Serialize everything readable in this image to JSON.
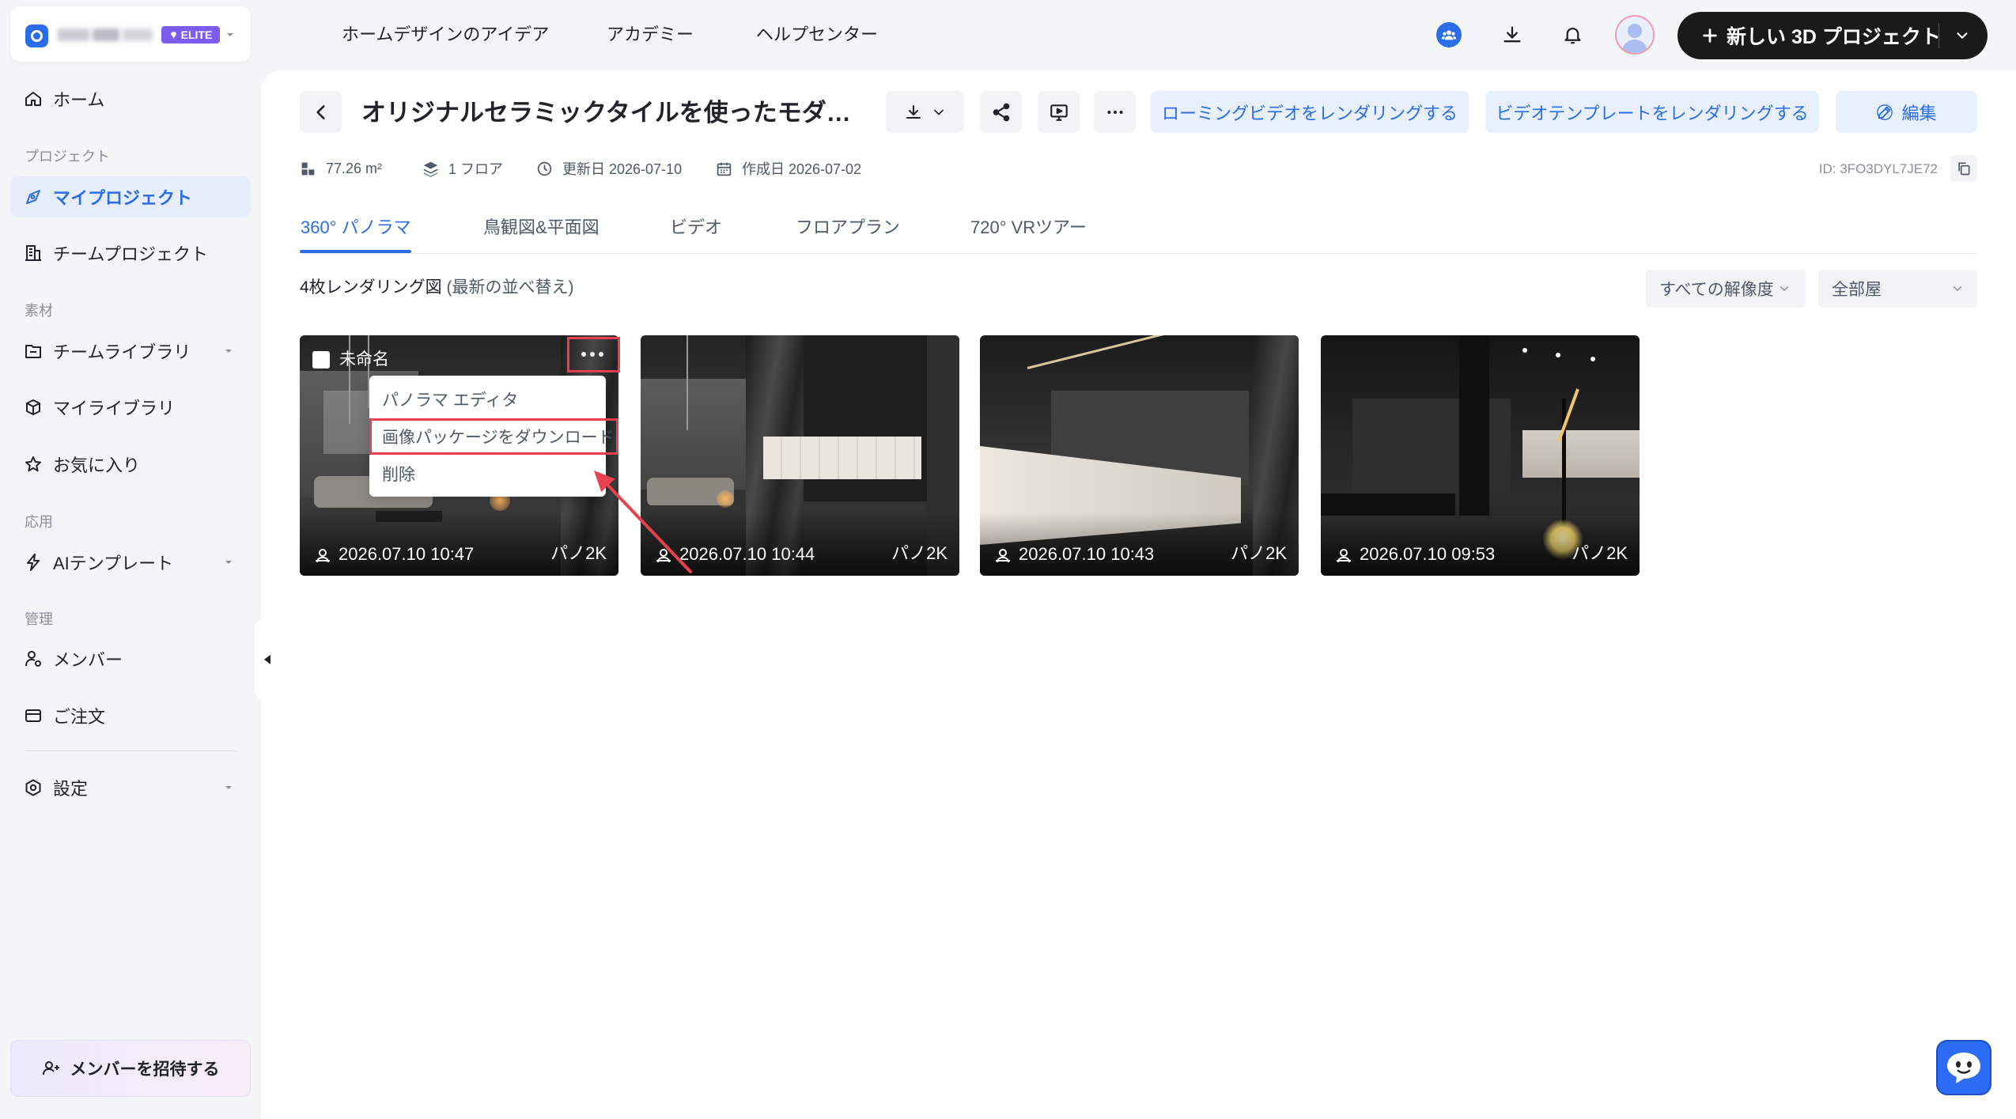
{
  "sidebar": {
    "brand_badge": "ELITE",
    "home": "ホーム",
    "sections": {
      "project": "プロジェクト",
      "material": "素材",
      "apps": "応用",
      "admin": "管理"
    },
    "items": {
      "my_projects": "マイプロジェクト",
      "team_projects": "チームプロジェクト",
      "team_library": "チームライブラリ",
      "my_library": "マイライブラリ",
      "favorites": "お気に入り",
      "ai_templates": "AIテンプレート",
      "members": "メンバー",
      "orders": "ご注文",
      "settings": "設定"
    },
    "invite_button": "メンバーを招待する"
  },
  "header": {
    "nav": [
      "ホームデザインのアイデア",
      "アカデミー",
      "ヘルプセンター"
    ],
    "icons": [
      "team-icon",
      "download-icon",
      "bell-icon",
      "avatar"
    ],
    "new_project_button": "新しい 3D プロジェクト"
  },
  "project": {
    "title": "オリジナルセラミックタイルを使ったモダ…",
    "toolbar_icons": [
      "download-icon",
      "share-icon",
      "present-icon",
      "more-icon"
    ],
    "actions": {
      "render_roaming": "ローミングビデオをレンダリングする",
      "render_template": "ビデオテンプレートをレンダリングする",
      "edit": "編集"
    },
    "meta": {
      "area": "77.26 m²",
      "floors": "1 フロア",
      "updated": "更新日 2026-07-10",
      "created": "作成日 2026-07-02",
      "id": "ID: 3FO3DYL7JE72"
    }
  },
  "tabs": [
    {
      "label": "360° パノラマ",
      "active": true
    },
    {
      "label": "鳥観図&平面図",
      "active": false
    },
    {
      "label": "ビデオ",
      "active": false
    },
    {
      "label": "フロアプラン",
      "active": false
    },
    {
      "label": "720° VRツアー",
      "active": false
    }
  ],
  "gallery": {
    "count": "4枚レンダリング図",
    "sort": "(最新の並べ替え)",
    "filters": {
      "resolution": "すべての解像度",
      "room": "全部屋"
    },
    "cards": [
      {
        "title": "未命名",
        "timestamp": "2026.07.10 10:47",
        "resolution": "パノ2K",
        "menu_open": true
      },
      {
        "timestamp": "2026.07.10 10:44",
        "resolution": "パノ2K"
      },
      {
        "timestamp": "2026.07.10 10:43",
        "resolution": "パノ2K"
      },
      {
        "timestamp": "2026.07.10 09:53",
        "resolution": "パノ2K"
      }
    ]
  },
  "context_menu": {
    "items": [
      "パノラマ エディタ",
      "画像パッケージをダウンロード",
      "削除"
    ],
    "highlighted_index": 1
  },
  "colors": {
    "accent": "#2b6de8",
    "accent_soft": "#e8f0fe",
    "annotation": "#e8414d",
    "elite_badge": "#7b5cf5",
    "primary_button": "#1a1a1a",
    "sidebar_bg": "#f4f5f7"
  }
}
